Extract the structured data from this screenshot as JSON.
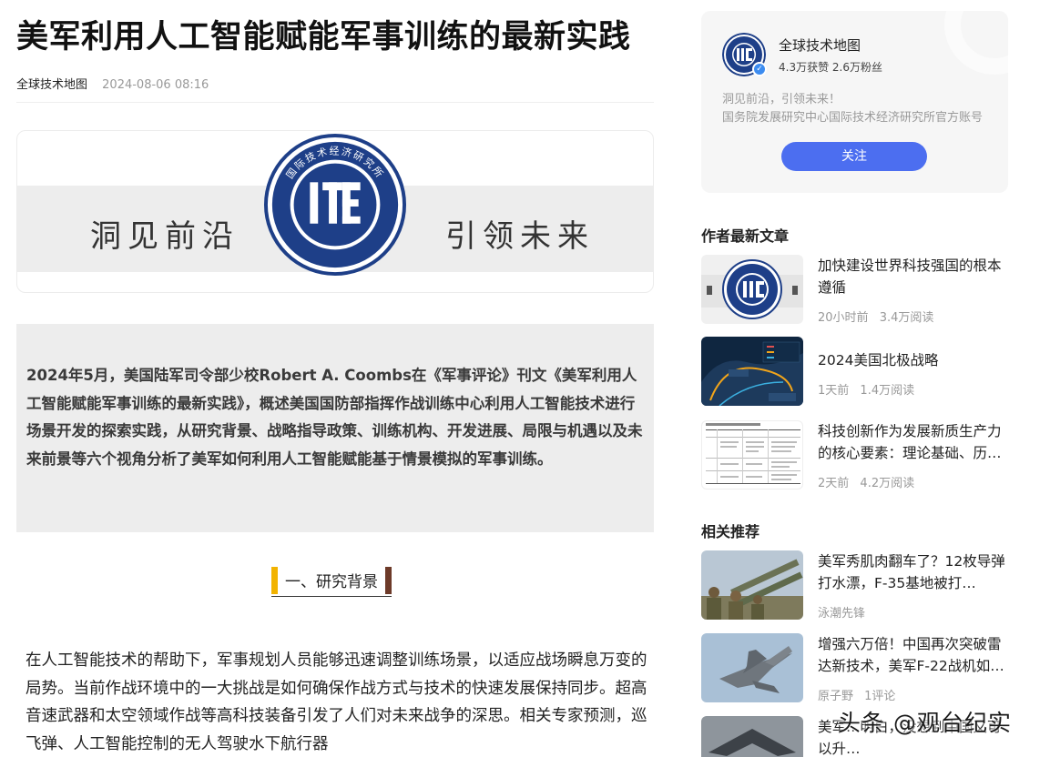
{
  "article": {
    "title": "美军利用人工智能赋能军事训练的最新实践",
    "author": "全球技术地图",
    "date": "2024-08-06 08:16",
    "banner": {
      "slogan_left": "洞见前沿",
      "slogan_right": "引领未来",
      "logo_text": "国际技术经济研究所"
    },
    "summary": "2024年5月，美国陆军司令部少校Robert A. Coombs在《军事评论》刊文《美军利用人工智能赋能军事训练的最新实践》，概述美国国防部指挥作战训练中心利用人工智能技术进行场景开发的探索实践，从研究背景、战略指导政策、训练机构、开发进展、局限与机遇以及未来前景等六个视角分析了美军如何利用人工智能赋能基于情景模拟的军事训练。",
    "section_title": "一、研究背景",
    "body": "在人工智能技术的帮助下，军事规划人员能够迅速调整训练场景，以适应战场瞬息万变的局势。当前作战环境中的一大挑战是如何确保作战方式与技术的快速发展保持同步。超高音速武器和太空领域作战等高科技装备引发了人们对未来战争的深思。相关专家预测，巡飞弹、人工智能控制的无人驾驶水下航行器"
  },
  "author_card": {
    "name": "全球技术地图",
    "stats": "4.3万获赞 2.6万粉丝",
    "bio_line1": "洞见前沿，引领未来！",
    "bio_line2": "国务院发展研究中心国际技术经济研究所官方账号",
    "follow_label": "关注"
  },
  "latest": {
    "heading": "作者最新文章",
    "items": [
      {
        "title": "加快建设世界科技强国的根本遵循",
        "time": "20小时前",
        "reads": "3.4万阅读"
      },
      {
        "title": "2024美国北极战略",
        "time": "1天前",
        "reads": "1.4万阅读"
      },
      {
        "title": "科技创新作为发展新质生产力的核心要素：理论基础、历…",
        "time": "2天前",
        "reads": "4.2万阅读"
      }
    ]
  },
  "related": {
    "heading": "相关推荐",
    "items": [
      {
        "title": "美军秀肌肉翻车了？12枚导弹打水漂，F-35基地被打…",
        "source": "泳潮先锋",
        "comments": ""
      },
      {
        "title": "增强六万倍！中国再次突破雷达新技术，美军F-22战机如…",
        "source": "原子野",
        "comments": "1评论"
      },
      {
        "title": "美军…明白，没想到中国又可以升…",
        "source": "",
        "comments": ""
      }
    ]
  },
  "watermark": "头条 @观台纪实",
  "colors": {
    "accent_blue": "#4c6ef0",
    "section_bar_left": "#f2b300",
    "section_bar_right": "#6d3a29",
    "summary_bg": "#ededed"
  }
}
